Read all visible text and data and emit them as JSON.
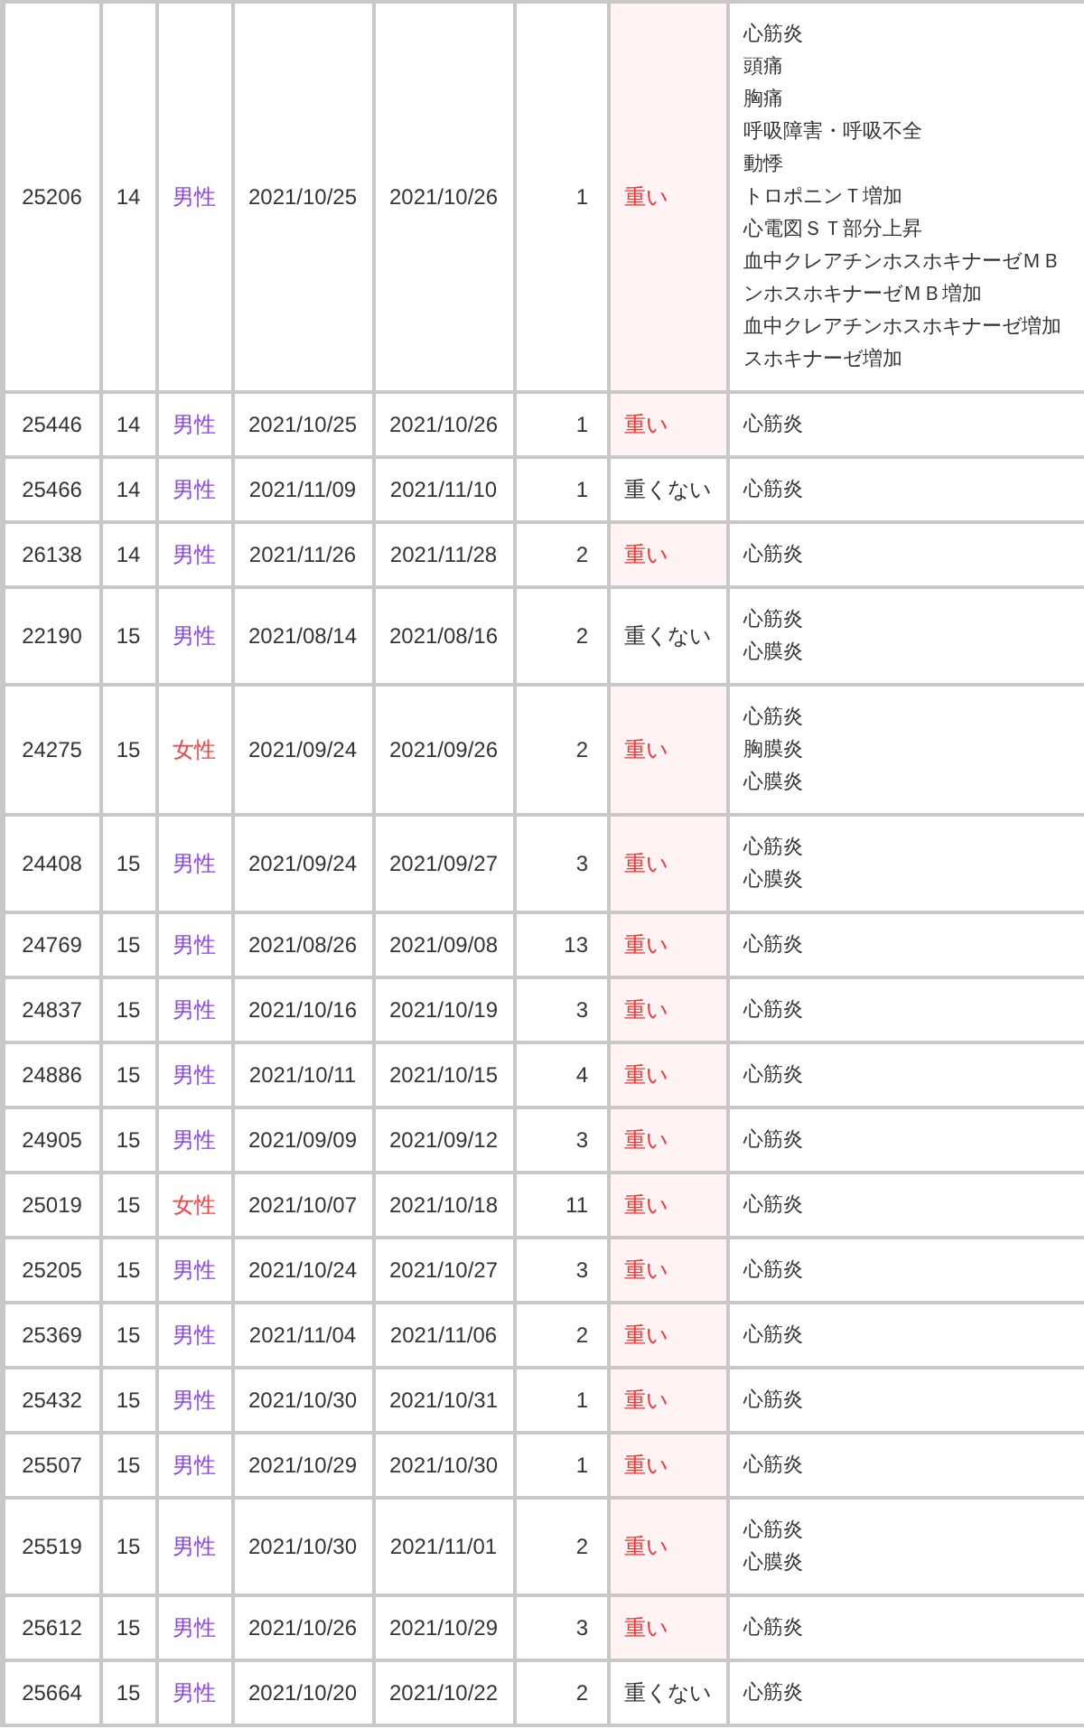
{
  "table": {
    "rows": [
      {
        "id": "25206",
        "age": "14",
        "sex": {
          "text": "男性",
          "kind": "male"
        },
        "onset": "2021/10/25",
        "report": "2021/10/26",
        "days": "1",
        "severity": {
          "text": "重い",
          "serious": true
        },
        "symptoms": [
          "心筋炎",
          "頭痛",
          "胸痛",
          "呼吸障害・呼吸不全",
          "動悸",
          "トロポニンＴ増加",
          "心電図ＳＴ部分上昇",
          "血中クレアチンホスホキナーゼＭＢ",
          "ンホスホキナーゼＭＢ増加",
          "血中クレアチンホスホキナーゼ増加",
          "スホキナーゼ増加"
        ]
      },
      {
        "id": "25446",
        "age": "14",
        "sex": {
          "text": "男性",
          "kind": "male"
        },
        "onset": "2021/10/25",
        "report": "2021/10/26",
        "days": "1",
        "severity": {
          "text": "重い",
          "serious": true
        },
        "symptoms": [
          "心筋炎"
        ]
      },
      {
        "id": "25466",
        "age": "14",
        "sex": {
          "text": "男性",
          "kind": "male"
        },
        "onset": "2021/11/09",
        "report": "2021/11/10",
        "days": "1",
        "severity": {
          "text": "重くない",
          "serious": false
        },
        "symptoms": [
          "心筋炎"
        ]
      },
      {
        "id": "26138",
        "age": "14",
        "sex": {
          "text": "男性",
          "kind": "male"
        },
        "onset": "2021/11/26",
        "report": "2021/11/28",
        "days": "2",
        "severity": {
          "text": "重い",
          "serious": true
        },
        "symptoms": [
          "心筋炎"
        ]
      },
      {
        "id": "22190",
        "age": "15",
        "sex": {
          "text": "男性",
          "kind": "male"
        },
        "onset": "2021/08/14",
        "report": "2021/08/16",
        "days": "2",
        "severity": {
          "text": "重くない",
          "serious": false
        },
        "symptoms": [
          "心筋炎",
          "心膜炎"
        ]
      },
      {
        "id": "24275",
        "age": "15",
        "sex": {
          "text": "女性",
          "kind": "female"
        },
        "onset": "2021/09/24",
        "report": "2021/09/26",
        "days": "2",
        "severity": {
          "text": "重い",
          "serious": true
        },
        "symptoms": [
          "心筋炎",
          "胸膜炎",
          "心膜炎"
        ]
      },
      {
        "id": "24408",
        "age": "15",
        "sex": {
          "text": "男性",
          "kind": "male"
        },
        "onset": "2021/09/24",
        "report": "2021/09/27",
        "days": "3",
        "severity": {
          "text": "重い",
          "serious": true
        },
        "symptoms": [
          "心筋炎",
          "心膜炎"
        ]
      },
      {
        "id": "24769",
        "age": "15",
        "sex": {
          "text": "男性",
          "kind": "male"
        },
        "onset": "2021/08/26",
        "report": "2021/09/08",
        "days": "13",
        "severity": {
          "text": "重い",
          "serious": true
        },
        "symptoms": [
          "心筋炎"
        ]
      },
      {
        "id": "24837",
        "age": "15",
        "sex": {
          "text": "男性",
          "kind": "male"
        },
        "onset": "2021/10/16",
        "report": "2021/10/19",
        "days": "3",
        "severity": {
          "text": "重い",
          "serious": true
        },
        "symptoms": [
          "心筋炎"
        ]
      },
      {
        "id": "24886",
        "age": "15",
        "sex": {
          "text": "男性",
          "kind": "male"
        },
        "onset": "2021/10/11",
        "report": "2021/10/15",
        "days": "4",
        "severity": {
          "text": "重い",
          "serious": true
        },
        "symptoms": [
          "心筋炎"
        ]
      },
      {
        "id": "24905",
        "age": "15",
        "sex": {
          "text": "男性",
          "kind": "male"
        },
        "onset": "2021/09/09",
        "report": "2021/09/12",
        "days": "3",
        "severity": {
          "text": "重い",
          "serious": true
        },
        "symptoms": [
          "心筋炎"
        ]
      },
      {
        "id": "25019",
        "age": "15",
        "sex": {
          "text": "女性",
          "kind": "female"
        },
        "onset": "2021/10/07",
        "report": "2021/10/18",
        "days": "11",
        "severity": {
          "text": "重い",
          "serious": true
        },
        "symptoms": [
          "心筋炎"
        ]
      },
      {
        "id": "25205",
        "age": "15",
        "sex": {
          "text": "男性",
          "kind": "male"
        },
        "onset": "2021/10/24",
        "report": "2021/10/27",
        "days": "3",
        "severity": {
          "text": "重い",
          "serious": true
        },
        "symptoms": [
          "心筋炎"
        ]
      },
      {
        "id": "25369",
        "age": "15",
        "sex": {
          "text": "男性",
          "kind": "male"
        },
        "onset": "2021/11/04",
        "report": "2021/11/06",
        "days": "2",
        "severity": {
          "text": "重い",
          "serious": true
        },
        "symptoms": [
          "心筋炎"
        ]
      },
      {
        "id": "25432",
        "age": "15",
        "sex": {
          "text": "男性",
          "kind": "male"
        },
        "onset": "2021/10/30",
        "report": "2021/10/31",
        "days": "1",
        "severity": {
          "text": "重い",
          "serious": true
        },
        "symptoms": [
          "心筋炎"
        ]
      },
      {
        "id": "25507",
        "age": "15",
        "sex": {
          "text": "男性",
          "kind": "male"
        },
        "onset": "2021/10/29",
        "report": "2021/10/30",
        "days": "1",
        "severity": {
          "text": "重い",
          "serious": true
        },
        "symptoms": [
          "心筋炎"
        ]
      },
      {
        "id": "25519",
        "age": "15",
        "sex": {
          "text": "男性",
          "kind": "male"
        },
        "onset": "2021/10/30",
        "report": "2021/11/01",
        "days": "2",
        "severity": {
          "text": "重い",
          "serious": true
        },
        "symptoms": [
          "心筋炎",
          "心膜炎"
        ]
      },
      {
        "id": "25612",
        "age": "15",
        "sex": {
          "text": "男性",
          "kind": "male"
        },
        "onset": "2021/10/26",
        "report": "2021/10/29",
        "days": "3",
        "severity": {
          "text": "重い",
          "serious": true
        },
        "symptoms": [
          "心筋炎"
        ]
      },
      {
        "id": "25664",
        "age": "15",
        "sex": {
          "text": "男性",
          "kind": "male"
        },
        "onset": "2021/10/20",
        "report": "2021/10/22",
        "days": "2",
        "severity": {
          "text": "重くない",
          "serious": false
        },
        "symptoms": [
          "心筋炎"
        ]
      }
    ]
  }
}
